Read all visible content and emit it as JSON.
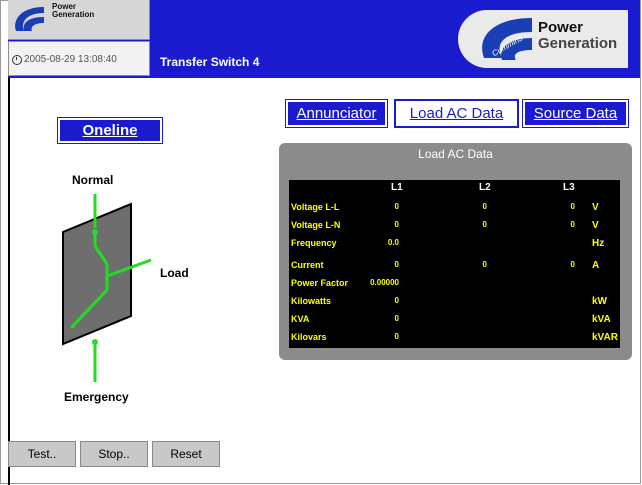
{
  "header": {
    "brand_small_line1": "Power",
    "brand_small_line2": "Generation",
    "datetime": "2005-08-29 13:08:40",
    "screen_title": "Transfer Switch 4",
    "logo_word": "Cummins",
    "logo_text_line1": "Power",
    "logo_text_line2": "Generation"
  },
  "nav": {
    "oneline": "Oneline",
    "annunciator": "Annunciator",
    "load_ac_data": "Load AC Data",
    "source_data": "Source Data"
  },
  "oneline": {
    "normal": "Normal",
    "load": "Load",
    "emergency": "Emergency"
  },
  "panel": {
    "title": "Load AC Data",
    "columns": [
      "L1",
      "L2",
      "L3"
    ],
    "rows": [
      {
        "label": "Voltage L-L",
        "l1": "0",
        "l2": "0",
        "l3": "0",
        "unit": "V"
      },
      {
        "label": "Voltage L-N",
        "l1": "0",
        "l2": "0",
        "l3": "0",
        "unit": "V"
      },
      {
        "label": "Frequency",
        "l1": "0.0",
        "l2": "",
        "l3": "",
        "unit": "Hz"
      },
      {
        "label": "Current",
        "l1": "0",
        "l2": "0",
        "l3": "0",
        "unit": "A"
      },
      {
        "label": "Power Factor",
        "l1": "0.00000",
        "l2": "",
        "l3": "",
        "unit": ""
      },
      {
        "label": "Kilowatts",
        "l1": "0",
        "l2": "",
        "l3": "",
        "unit": "kW"
      },
      {
        "label": "KVA",
        "l1": "0",
        "l2": "",
        "l3": "",
        "unit": "kVA"
      },
      {
        "label": "Kilovars",
        "l1": "0",
        "l2": "",
        "l3": "",
        "unit": "kVAR"
      }
    ]
  },
  "buttons": {
    "test": "Test..",
    "stop": "Stop..",
    "reset": "Reset"
  },
  "colors": {
    "header_blue": "#1a1bcf",
    "data_yellow": "#ffff00",
    "switch_green": "#22dd22"
  }
}
